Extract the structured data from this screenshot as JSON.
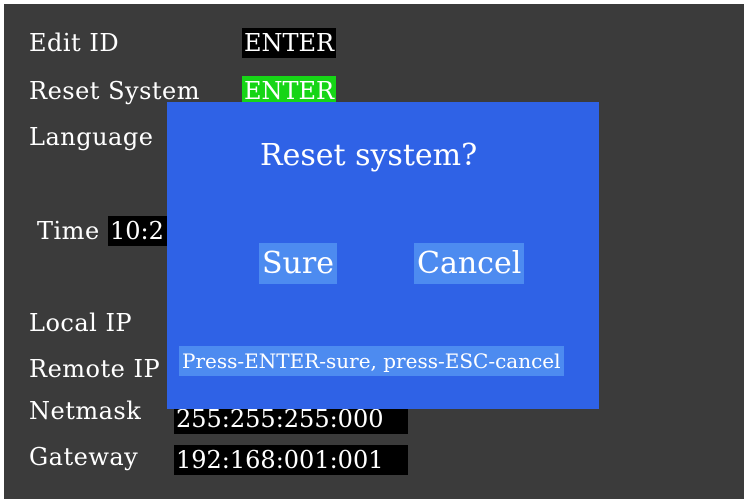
{
  "menu": {
    "edit_id": {
      "label": "Edit ID",
      "value": "ENTER"
    },
    "reset_system": {
      "label": "Reset System",
      "value": "ENTER"
    },
    "language": {
      "label": "Language"
    },
    "time": {
      "label": "Time",
      "value_visible": "10:2"
    },
    "local_ip": {
      "label": "Local IP"
    },
    "remote_ip": {
      "label": "Remote IP"
    },
    "netmask": {
      "label": "Netmask",
      "value": "255:255:255:000"
    },
    "gateway": {
      "label": "Gateway",
      "value": "192:168:001:001"
    }
  },
  "dialog": {
    "title": "Reset system?",
    "sure_label": "Sure",
    "cancel_label": "Cancel",
    "hint": "Press-ENTER-sure, press-ESC-cancel"
  },
  "colors": {
    "screen_background": "#3b3b3b",
    "dialog_background": "#2f62e6",
    "button_background": "#4d8bf0",
    "selected_value_background": "#16d516",
    "value_background": "#000000",
    "text": "#ffffff"
  }
}
